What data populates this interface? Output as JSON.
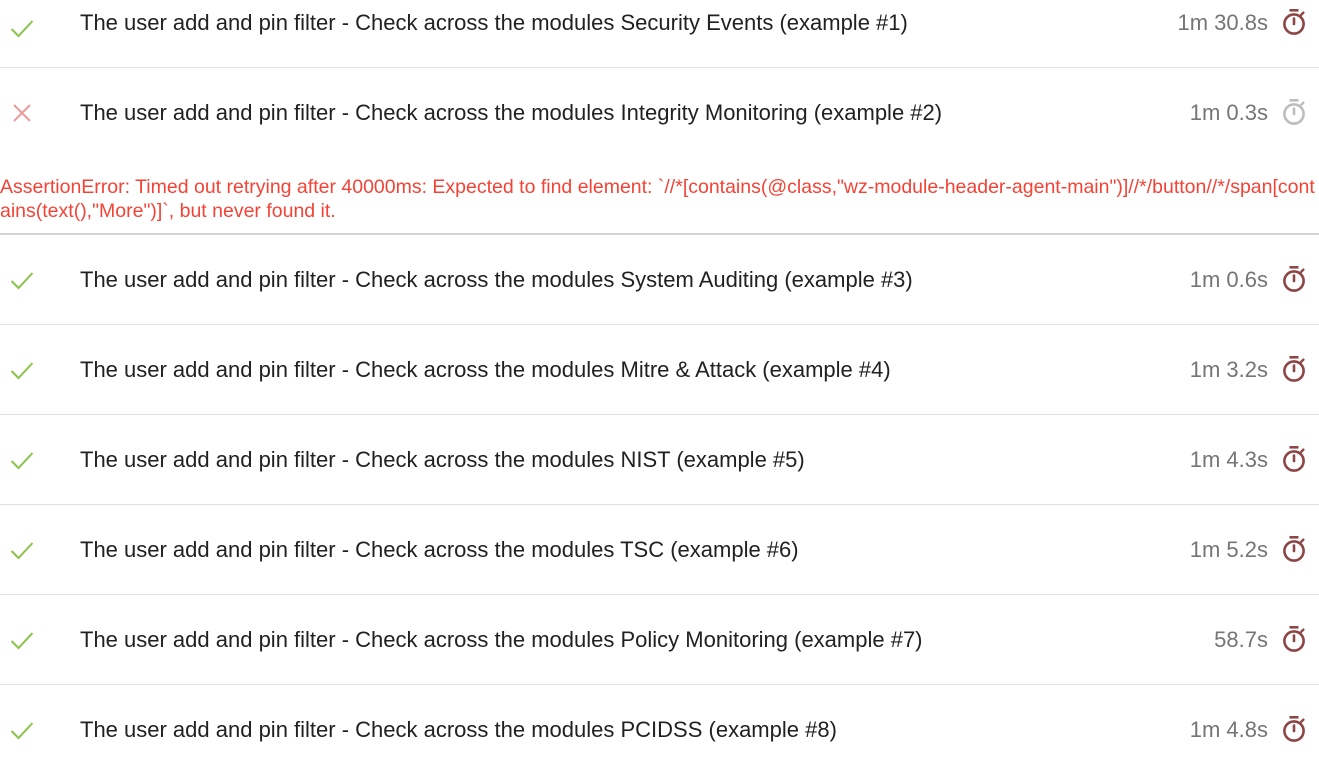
{
  "colors": {
    "pass_icon": "#8bc34a",
    "fail_icon": "#ef9a9a",
    "timer_slow": "#8d4545",
    "timer_normal": "#bdbdbd",
    "error_text": "#f44336"
  },
  "tests": [
    {
      "status": "passed",
      "status_icon": "check-icon",
      "title": "The user add and pin filter - Check across the modules Security Events (example #1)",
      "duration": "1m 30.8s",
      "timer_icon": "stopwatch-icon",
      "timer_style": "slow"
    },
    {
      "status": "failed",
      "status_icon": "cross-icon",
      "title": "The user add and pin filter - Check across the modules Integrity Monitoring (example #2)",
      "duration": "1m 0.3s",
      "timer_icon": "stopwatch-icon",
      "timer_style": "normal",
      "error": "AssertionError: Timed out retrying after 40000ms: Expected to find element: `//*[contains(@class,\"wz-module-header-agent-main\")]//*/button//*/span[contains(text(),\"More\")]`, but never found it."
    },
    {
      "status": "passed",
      "status_icon": "check-icon",
      "title": "The user add and pin filter - Check across the modules System Auditing (example #3)",
      "duration": "1m 0.6s",
      "timer_icon": "stopwatch-icon",
      "timer_style": "slow"
    },
    {
      "status": "passed",
      "status_icon": "check-icon",
      "title": "The user add and pin filter - Check across the modules Mitre & Attack (example #4)",
      "duration": "1m 3.2s",
      "timer_icon": "stopwatch-icon",
      "timer_style": "slow"
    },
    {
      "status": "passed",
      "status_icon": "check-icon",
      "title": "The user add and pin filter - Check across the modules NIST (example #5)",
      "duration": "1m 4.3s",
      "timer_icon": "stopwatch-icon",
      "timer_style": "slow"
    },
    {
      "status": "passed",
      "status_icon": "check-icon",
      "title": "The user add and pin filter - Check across the modules TSC (example #6)",
      "duration": "1m 5.2s",
      "timer_icon": "stopwatch-icon",
      "timer_style": "slow"
    },
    {
      "status": "passed",
      "status_icon": "check-icon",
      "title": "The user add and pin filter - Check across the modules Policy Monitoring (example #7)",
      "duration": "58.7s",
      "timer_icon": "stopwatch-icon",
      "timer_style": "slow"
    },
    {
      "status": "passed",
      "status_icon": "check-icon",
      "title": "The user add and pin filter - Check across the modules PCIDSS (example #8)",
      "duration": "1m 4.8s",
      "timer_icon": "stopwatch-icon",
      "timer_style": "slow"
    }
  ]
}
